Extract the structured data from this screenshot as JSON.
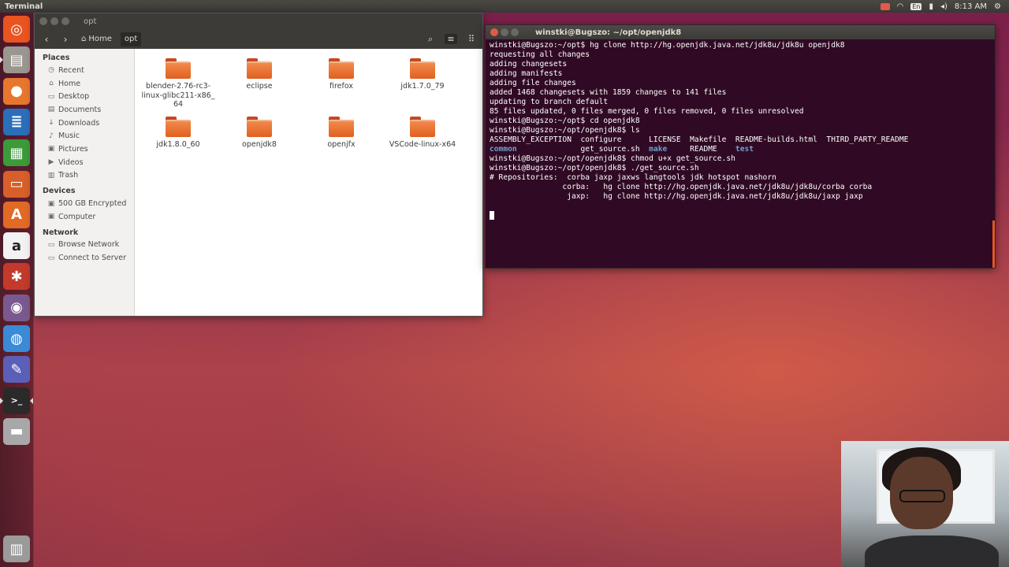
{
  "top_panel": {
    "app_title": "Terminal",
    "clock": "8:13 AM",
    "lang": "En"
  },
  "launcher": {
    "items": [
      {
        "name": "ubuntu-dash-icon",
        "glyph": "◎",
        "bg": "#e95420"
      },
      {
        "name": "files-launcher-icon",
        "glyph": "▤",
        "bg": "#9a9690"
      },
      {
        "name": "firefox-launcher-icon",
        "glyph": "●",
        "bg": "#e8772e"
      },
      {
        "name": "writer-launcher-icon",
        "glyph": "≣",
        "bg": "#2a6fb8"
      },
      {
        "name": "calc-launcher-icon",
        "glyph": "▦",
        "bg": "#3c9a3a"
      },
      {
        "name": "impress-launcher-icon",
        "glyph": "▭",
        "bg": "#d65f2a"
      },
      {
        "name": "software-center-icon",
        "glyph": "A",
        "bg": "#e06a26"
      },
      {
        "name": "amazon-launcher-icon",
        "glyph": "a",
        "bg": "#f2f2f2"
      },
      {
        "name": "settings-launcher-icon",
        "glyph": "✱",
        "bg": "#c23a2c"
      },
      {
        "name": "webcam-app-icon",
        "glyph": "◉",
        "bg": "#7a5a8e"
      },
      {
        "name": "chrome-launcher-icon",
        "glyph": "◍",
        "bg": "#3a8ad6"
      },
      {
        "name": "editor-launcher-icon",
        "glyph": "✎",
        "bg": "#5b5fb8"
      },
      {
        "name": "terminal-launcher-icon",
        "glyph": ">_",
        "bg": "#2a2a2a"
      },
      {
        "name": "drive-launcher-icon",
        "glyph": "▬",
        "bg": "#a8a8a8"
      }
    ],
    "trash": {
      "glyph": "▥",
      "bg": "#9a9a9a"
    }
  },
  "files": {
    "window_title": "opt",
    "breadcrumbs": [
      {
        "label": "Home",
        "icon": "⌂"
      },
      {
        "label": "opt",
        "icon": ""
      }
    ],
    "sidebar": {
      "places_heading": "Places",
      "places": [
        {
          "label": "Recent",
          "icon": "◷"
        },
        {
          "label": "Home",
          "icon": "⌂"
        },
        {
          "label": "Desktop",
          "icon": "▭"
        },
        {
          "label": "Documents",
          "icon": "▤"
        },
        {
          "label": "Downloads",
          "icon": "↓"
        },
        {
          "label": "Music",
          "icon": "♪"
        },
        {
          "label": "Pictures",
          "icon": "▣"
        },
        {
          "label": "Videos",
          "icon": "▶"
        },
        {
          "label": "Trash",
          "icon": "▥"
        }
      ],
      "devices_heading": "Devices",
      "devices": [
        {
          "label": "500 GB Encrypted",
          "icon": "▣"
        },
        {
          "label": "Computer",
          "icon": "▣"
        }
      ],
      "network_heading": "Network",
      "network": [
        {
          "label": "Browse Network",
          "icon": "▭"
        },
        {
          "label": "Connect to Server",
          "icon": "▭"
        }
      ]
    },
    "folders": [
      {
        "name": "blender-2.76-rc3-linux-glibc211-x86_64",
        "lines": [
          "blender-2.76-rc3-",
          "linux-glibc211-x86_",
          "64"
        ]
      },
      {
        "name": "eclipse",
        "lines": [
          "eclipse"
        ]
      },
      {
        "name": "firefox",
        "lines": [
          "firefox"
        ]
      },
      {
        "name": "jdk1.7.0_79",
        "lines": [
          "jdk1.7.0_79"
        ]
      },
      {
        "name": "jdk1.8.0_60",
        "lines": [
          "jdk1.8.0_60"
        ]
      },
      {
        "name": "openjdk8",
        "lines": [
          "openjdk8"
        ]
      },
      {
        "name": "openjfx",
        "lines": [
          "openjfx"
        ]
      },
      {
        "name": "VSCode-linux-x64",
        "lines": [
          "VSCode-linux-x64"
        ]
      }
    ]
  },
  "terminal": {
    "title": "winstki@Bugszo: ~/opt/openjdk8",
    "lines": [
      [
        {
          "t": "winstki@Bugszo:~/opt$ hg clone http://hg.openjdk.java.net/jdk8u/jdk8u openjdk8"
        }
      ],
      [
        {
          "t": "requesting all changes"
        }
      ],
      [
        {
          "t": "adding changesets"
        }
      ],
      [
        {
          "t": "adding manifests"
        }
      ],
      [
        {
          "t": "adding file changes"
        }
      ],
      [
        {
          "t": "added 1468 changesets with 1859 changes to 141 files"
        }
      ],
      [
        {
          "t": "updating to branch default"
        }
      ],
      [
        {
          "t": "85 files updated, 0 files merged, 0 files removed, 0 files unresolved"
        }
      ],
      [
        {
          "t": "winstki@Bugszo:~/opt$ cd openjdk8"
        }
      ],
      [
        {
          "t": "winstki@Bugszo:~/opt/openjdk8$ ls"
        }
      ],
      [
        {
          "t": "ASSEMBLY_EXCEPTION  configure      LICENSE  Makefile  README-builds.html  THIRD_PARTY_README"
        }
      ],
      [
        {
          "t": "common",
          "c": "blue"
        },
        {
          "t": "              get_source.sh  "
        },
        {
          "t": "make",
          "c": "blue"
        },
        {
          "t": "     README    "
        },
        {
          "t": "test",
          "c": "blue"
        }
      ],
      [
        {
          "t": "winstki@Bugszo:~/opt/openjdk8$ chmod u+x get_source.sh"
        }
      ],
      [
        {
          "t": "winstki@Bugszo:~/opt/openjdk8$ ./get_source.sh"
        }
      ],
      [
        {
          "t": "# Repositories:  corba jaxp jaxws langtools jdk hotspot nashorn"
        }
      ],
      [
        {
          "t": "                corba:   hg clone http://hg.openjdk.java.net/jdk8u/jdk8u/corba corba"
        }
      ],
      [
        {
          "t": "                 jaxp:   hg clone http://hg.openjdk.java.net/jdk8u/jdk8u/jaxp jaxp"
        }
      ],
      [
        {
          "t": ""
        }
      ],
      [
        {
          "cursor": true
        }
      ]
    ]
  }
}
